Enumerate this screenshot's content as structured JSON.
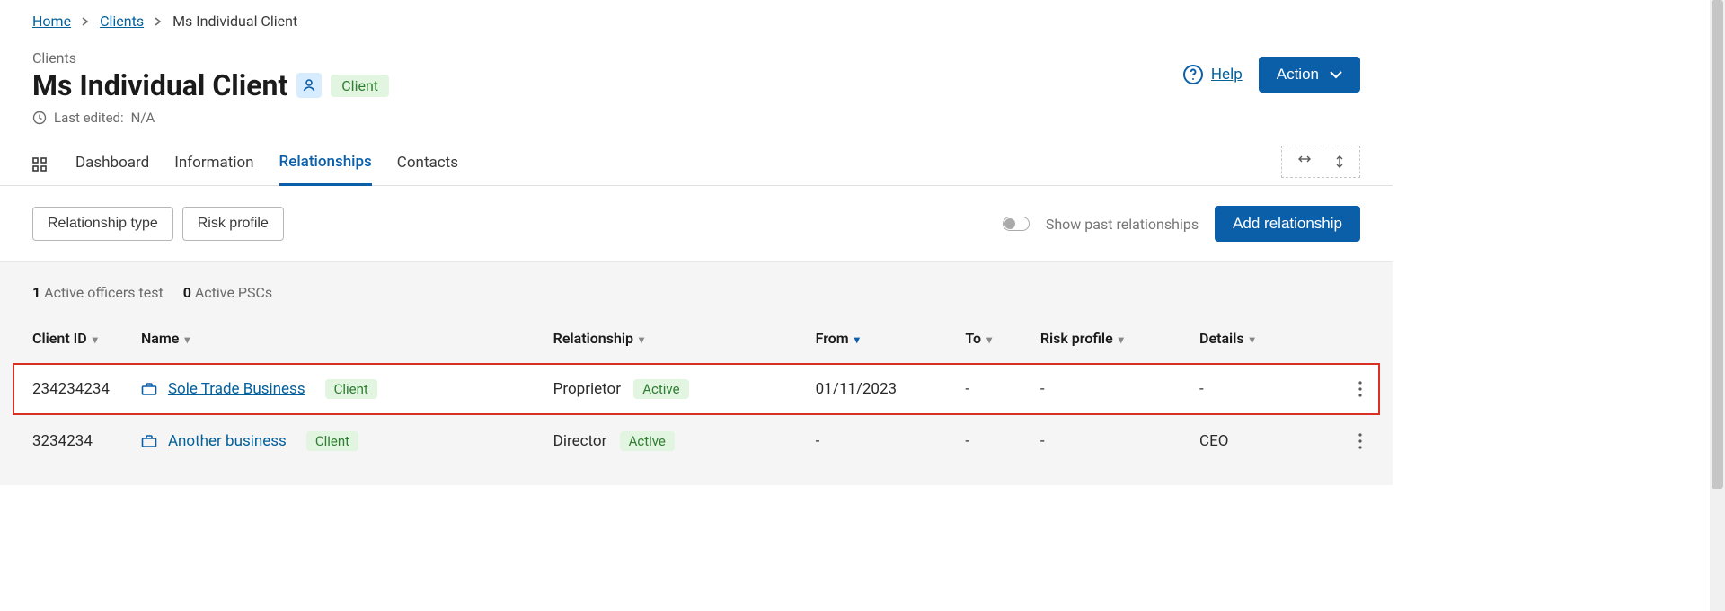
{
  "breadcrumb": {
    "home": "Home",
    "clients": "Clients",
    "current": "Ms Individual Client"
  },
  "header": {
    "section_label": "Clients",
    "title": "Ms Individual Client",
    "badge": "Client",
    "last_edited_label": "Last edited:",
    "last_edited_value": "N/A",
    "help": "Help",
    "action_button": "Action"
  },
  "tabs": {
    "dashboard": "Dashboard",
    "information": "Information",
    "relationships": "Relationships",
    "contacts": "Contacts"
  },
  "filters": {
    "relationship_type": "Relationship type",
    "risk_profile": "Risk profile",
    "show_past": "Show past relationships",
    "add_button": "Add relationship"
  },
  "stats": {
    "officers_count": "1",
    "officers_label": "Active officers test",
    "pscs_count": "0",
    "pscs_label": "Active PSCs"
  },
  "columns": {
    "client_id": "Client ID",
    "name": "Name",
    "relationship": "Relationship",
    "from": "From",
    "to": "To",
    "risk_profile": "Risk profile",
    "details": "Details"
  },
  "rows": [
    {
      "client_id": "234234234",
      "name": "Sole Trade Business",
      "name_badge": "Client",
      "relationship": "Proprietor",
      "status": "Active",
      "from": "01/11/2023",
      "to": "-",
      "risk_profile": "-",
      "details": "-"
    },
    {
      "client_id": "3234234",
      "name": "Another business",
      "name_badge": "Client",
      "relationship": "Director",
      "status": "Active",
      "from": "-",
      "to": "-",
      "risk_profile": "-",
      "details": "CEO"
    }
  ]
}
